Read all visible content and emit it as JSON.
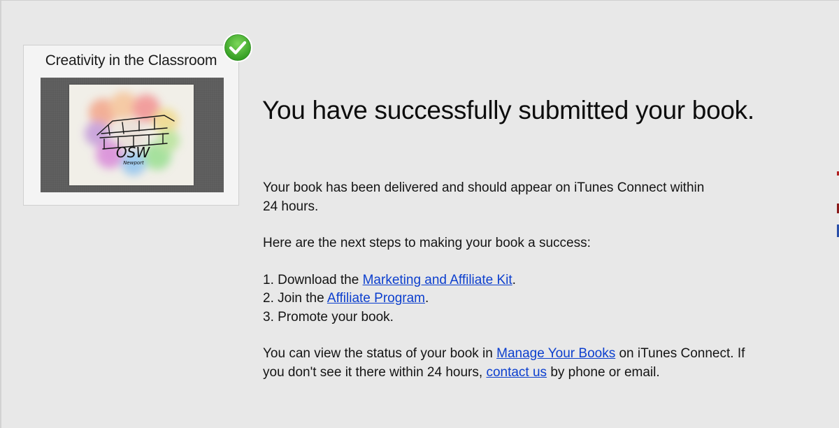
{
  "book": {
    "title": "Creativity in the Classroom",
    "cover_label_main": "OSW",
    "cover_label_sub": "Newport"
  },
  "heading": "You have successfully submitted your book.",
  "delivery": {
    "line1": "Your book has been delivered and should appear on iTunes Connect within",
    "line2": "24 hours."
  },
  "next_steps_intro": "Here are the next steps to making your book a success:",
  "steps": [
    {
      "prefix": "1. Download the ",
      "link": "Marketing and Affiliate Kit",
      "suffix": "."
    },
    {
      "prefix": "2. Join the ",
      "link": "Affiliate Program",
      "suffix": "."
    },
    {
      "prefix": "3. Promote your book.",
      "link": "",
      "suffix": ""
    }
  ],
  "status": {
    "prefix": "You can view the status of your book in ",
    "manage_link": "Manage Your Books",
    "middle": " on iTunes Connect. If",
    "line2_prefix": "you don't see it there within 24 hours, ",
    "contact_link": "contact us",
    "line2_suffix": " by phone or email."
  },
  "colors": {
    "background": "#e8e8e8",
    "link": "#0c3fce",
    "success_green": "#3fae29"
  },
  "icons": {
    "badge": "checkmark-circle-icon"
  }
}
